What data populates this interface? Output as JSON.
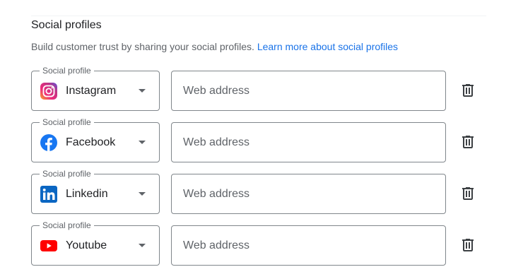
{
  "section": {
    "title": "Social profiles",
    "description": "Build customer trust by sharing your social profiles.",
    "learn_more_link": "Learn more about social profiles"
  },
  "colors": {
    "link": "#1a73e8",
    "border": "#80868b",
    "label": "#5f6368",
    "text": "#202124"
  },
  "profiles": [
    {
      "label": "Social profile",
      "platform": "Instagram",
      "icon": "instagram-icon",
      "url_placeholder": "Web address",
      "url_value": ""
    },
    {
      "label": "Social profile",
      "platform": "Facebook",
      "icon": "facebook-icon",
      "url_placeholder": "Web address",
      "url_value": ""
    },
    {
      "label": "Social profile",
      "platform": "Linkedin",
      "icon": "linkedin-icon",
      "url_placeholder": "Web address",
      "url_value": ""
    },
    {
      "label": "Social profile",
      "platform": "Youtube",
      "icon": "youtube-icon",
      "url_placeholder": "Web address",
      "url_value": ""
    }
  ]
}
